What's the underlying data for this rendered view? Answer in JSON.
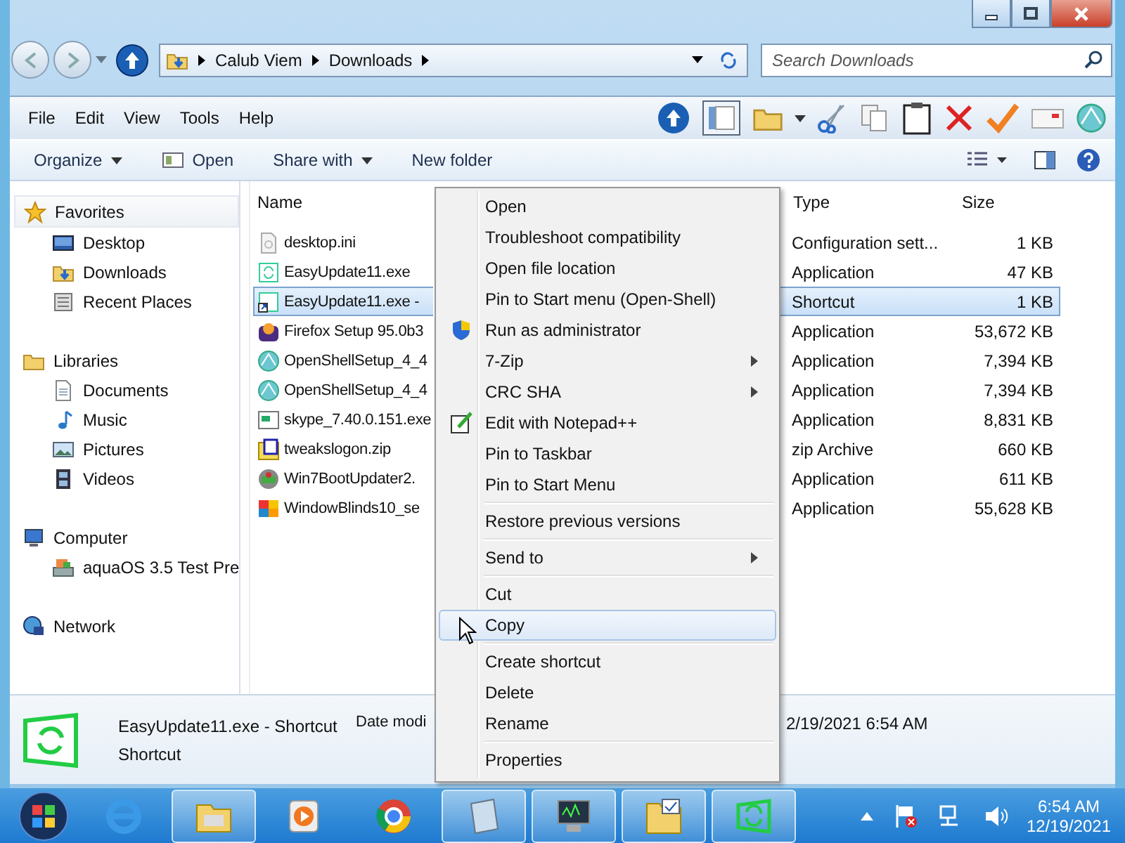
{
  "address": {
    "crumbs": [
      "Calub Viem",
      "Downloads"
    ]
  },
  "search": {
    "placeholder": "Search Downloads"
  },
  "menu_bar": [
    "File",
    "Edit",
    "View",
    "Tools",
    "Help"
  ],
  "command_bar": [
    {
      "label": "Open",
      "kind": "button"
    },
    {
      "label": "Share with",
      "kind": "dropdown"
    },
    {
      "label": "New folder",
      "kind": "plain"
    }
  ],
  "organize": "Organize",
  "nav": [
    {
      "label": "Favorites",
      "children": [
        {
          "label": "Desktop"
        },
        {
          "label": "Downloads"
        },
        {
          "label": "Recent Places"
        }
      ]
    },
    {
      "label": "Libraries",
      "children": [
        {
          "label": "Documents"
        },
        {
          "label": "Music"
        },
        {
          "label": "Pictures"
        },
        {
          "label": "Videos"
        }
      ]
    },
    {
      "label": "Computer",
      "children": [
        {
          "label": "aquaOS 3.5 Test Pre"
        }
      ]
    },
    {
      "label": "Network"
    }
  ],
  "columns": {
    "name": "Name",
    "type": "Type",
    "size": "Size"
  },
  "files": [
    {
      "name": "desktop.ini",
      "type": "Configuration sett...",
      "size": "1 KB",
      "selected": false
    },
    {
      "name": "EasyUpdate11.exe",
      "type": "Application",
      "size": "47 KB",
      "selected": false
    },
    {
      "name": "EasyUpdate11.exe -",
      "type": "Shortcut",
      "size": "1 KB",
      "selected": true
    },
    {
      "name": "Firefox Setup 95.0b3",
      "type": "Application",
      "size": "53,672 KB",
      "selected": false
    },
    {
      "name": "OpenShellSetup_4_4",
      "type": "Application",
      "size": "7,394 KB",
      "selected": false
    },
    {
      "name": "OpenShellSetup_4_4",
      "type": "Application",
      "size": "7,394 KB",
      "selected": false
    },
    {
      "name": "skype_7.40.0.151.exe",
      "type": "Application",
      "size": "8,831 KB",
      "selected": false
    },
    {
      "name": "tweakslogon.zip",
      "type": "zip Archive",
      "size": "660 KB",
      "selected": false
    },
    {
      "name": "Win7BootUpdater2.",
      "type": "Application",
      "size": "611 KB",
      "selected": false
    },
    {
      "name": "WindowBlinds10_se",
      "type": "Application",
      "size": "55,628 KB",
      "selected": false
    }
  ],
  "context_menu": [
    [
      {
        "label": "Open",
        "submenu": false,
        "selected": false
      },
      {
        "label": "Troubleshoot compatibility",
        "submenu": false,
        "selected": false
      },
      {
        "label": "Open file location",
        "submenu": false,
        "selected": false
      },
      {
        "label": "Pin to Start menu (Open-Shell)",
        "submenu": false,
        "selected": false
      },
      {
        "label": "Run as administrator",
        "submenu": false,
        "selected": false
      },
      {
        "label": "7-Zip",
        "submenu": true,
        "selected": false
      },
      {
        "label": "CRC SHA",
        "submenu": true,
        "selected": false
      },
      {
        "label": "Edit with Notepad++",
        "submenu": false,
        "selected": false
      },
      {
        "label": "Pin to Taskbar",
        "submenu": false,
        "selected": false
      },
      {
        "label": "Pin to Start Menu",
        "submenu": false,
        "selected": false
      }
    ],
    [
      {
        "label": "Restore previous versions",
        "submenu": false,
        "selected": false
      }
    ],
    [
      {
        "label": "Send to",
        "submenu": true,
        "selected": false
      }
    ],
    [
      {
        "label": "Cut",
        "submenu": false,
        "selected": false
      },
      {
        "label": "Copy",
        "submenu": false,
        "selected": true
      }
    ],
    [
      {
        "label": "Create shortcut",
        "submenu": false,
        "selected": false
      },
      {
        "label": "Delete",
        "submenu": false,
        "selected": false
      },
      {
        "label": "Rename",
        "submenu": false,
        "selected": false
      }
    ],
    [
      {
        "label": "Properties",
        "submenu": false,
        "selected": false
      }
    ]
  ],
  "details": {
    "name": "EasyUpdate11.exe - Shortcut",
    "type": "Shortcut",
    "date_label": "Date modi",
    "date": "2/19/2021 6:54 AM"
  },
  "taskbar": {
    "apps": [
      {
        "selected": false
      },
      {
        "selected": true
      },
      {
        "selected": false
      },
      {
        "selected": false
      },
      {
        "selected": true
      },
      {
        "selected": true
      },
      {
        "selected": true
      },
      {
        "selected": true
      }
    ],
    "time": "6:54 AM",
    "date": "12/19/2021"
  }
}
